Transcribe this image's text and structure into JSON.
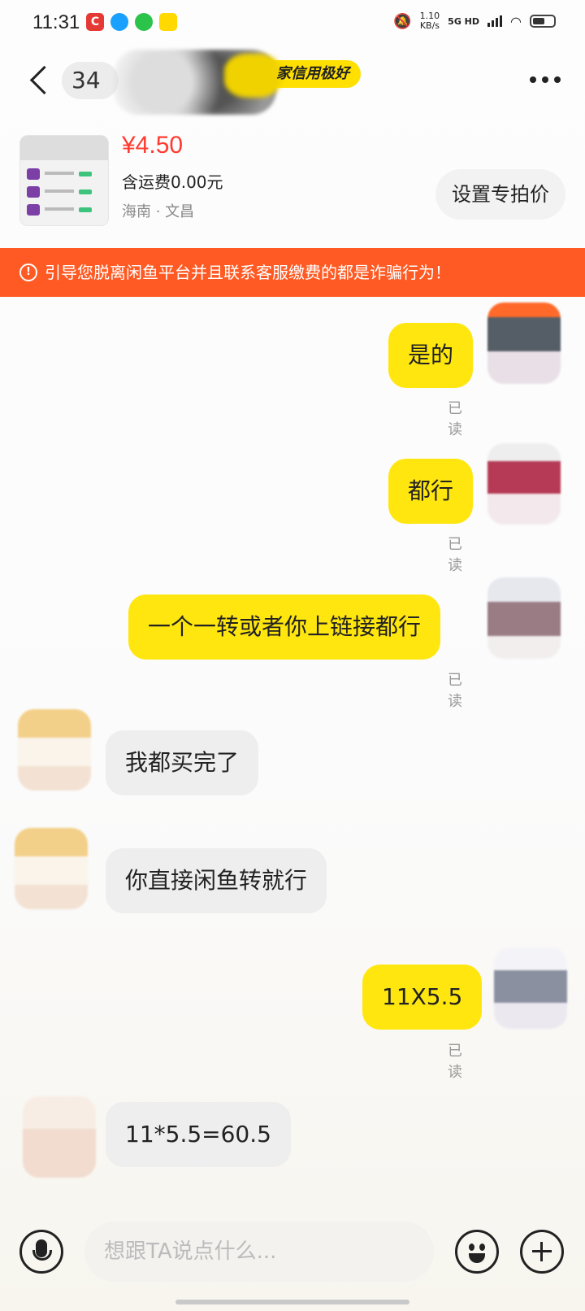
{
  "status_bar": {
    "time": "11:31",
    "net_speed": "1.10",
    "net_unit": "KB/s",
    "network": "5G HD"
  },
  "header": {
    "unread_count": "34",
    "credit_badge": "家信用极好"
  },
  "product": {
    "price": "¥4.50",
    "shipping": "含运费0.00元",
    "location": "海南 · 文昌",
    "special_price_button": "设置专拍价"
  },
  "warning": {
    "text": "引导您脱离闲鱼平台并且联系客服缴费的都是诈骗行为！"
  },
  "messages": [
    {
      "side": "me",
      "text": "是的",
      "status": "已读"
    },
    {
      "side": "me",
      "text": "都行",
      "status": "已读"
    },
    {
      "side": "me",
      "text": "一个一转或者你上链接都行",
      "status": "已读"
    },
    {
      "side": "them",
      "text": "我都买完了"
    },
    {
      "side": "them",
      "text": "你直接闲鱼转就行"
    },
    {
      "side": "me",
      "text": "11X5.5",
      "status": "已读"
    },
    {
      "side": "them",
      "text": "11*5.5=60.5"
    }
  ],
  "input": {
    "placeholder": "想跟TA说点什么..."
  },
  "colors": {
    "accent_yellow": "#ffe60f",
    "warning_orange": "#ff5a23",
    "price_red": "#ff3b30"
  }
}
